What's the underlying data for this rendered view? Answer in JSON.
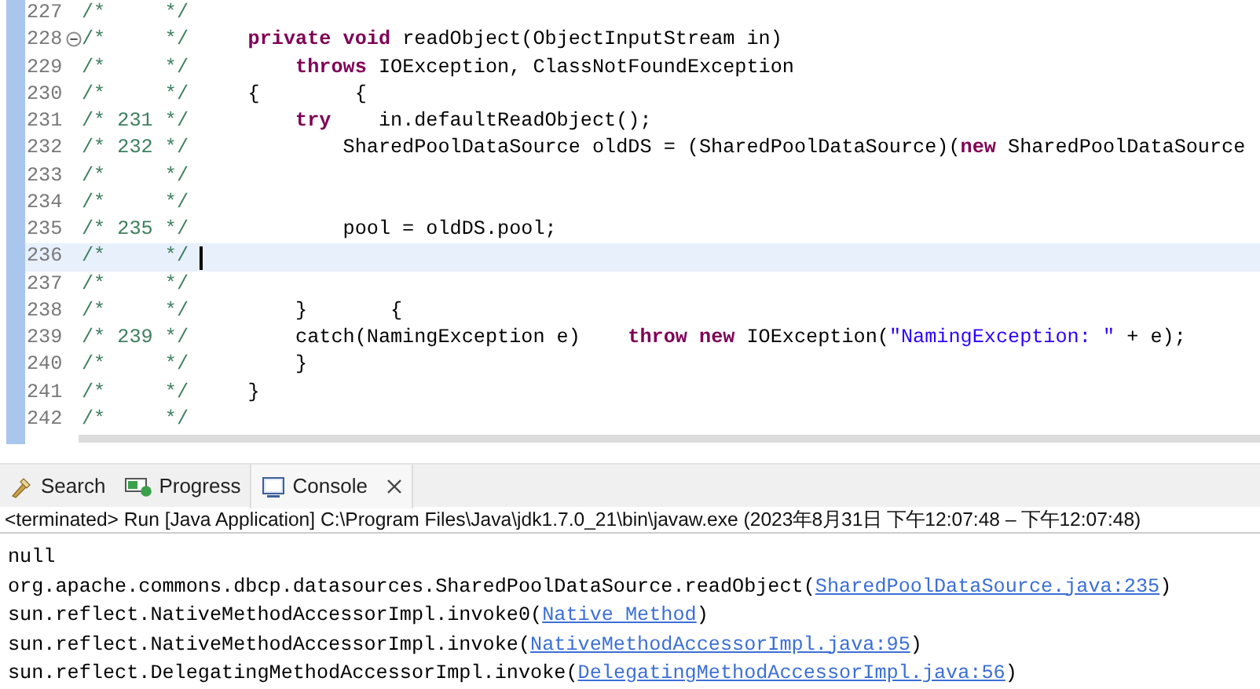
{
  "editor": {
    "lines": [
      {
        "number": "227",
        "collapsible": false,
        "current": false,
        "comment": "/*     */"
      },
      {
        "number": "228",
        "collapsible": true,
        "current": false,
        "comment": "/*     */",
        "tokens": [
          {
            "kind": "keyword",
            "text": "    private"
          },
          {
            "kind": "keyword",
            "text": " void"
          },
          {
            "kind": "plain",
            "text": " readObject(ObjectInputStream in)"
          }
        ]
      },
      {
        "number": "229",
        "collapsible": false,
        "current": false,
        "comment": "/*     */",
        "tokens": [
          {
            "kind": "keyword",
            "text": "        throws"
          },
          {
            "kind": "plain",
            "text": " IOException, ClassNotFoundException"
          }
        ]
      },
      {
        "number": "230",
        "collapsible": false,
        "current": false,
        "comment": "/*     */",
        "tokens": [
          {
            "kind": "plain",
            "text": "    {        {"
          }
        ]
      },
      {
        "number": "231",
        "collapsible": false,
        "current": false,
        "comment": "/* 231 */",
        "tokens": [
          {
            "kind": "keyword",
            "text": "        try"
          },
          {
            "kind": "plain",
            "text": "    in.defaultReadObject();"
          }
        ]
      },
      {
        "number": "232",
        "collapsible": false,
        "current": false,
        "comment": "/* 232 */",
        "tokens": [
          {
            "kind": "plain",
            "text": "            SharedPoolDataSource oldDS = (SharedPoolDataSource)("
          },
          {
            "kind": "keyword",
            "text": "new"
          },
          {
            "kind": "plain",
            "text": " SharedPoolDataSource"
          }
        ]
      },
      {
        "number": "233",
        "collapsible": false,
        "current": false,
        "comment": "/*     */"
      },
      {
        "number": "234",
        "collapsible": false,
        "current": false,
        "comment": "/*     */"
      },
      {
        "number": "235",
        "collapsible": false,
        "current": false,
        "comment": "/* 235 */",
        "tokens": [
          {
            "kind": "plain",
            "text": "            pool = oldDS.pool;"
          }
        ]
      },
      {
        "number": "236",
        "collapsible": false,
        "current": true,
        "comment": "/*     */"
      },
      {
        "number": "237",
        "collapsible": false,
        "current": false,
        "comment": "/*     */"
      },
      {
        "number": "238",
        "collapsible": false,
        "current": false,
        "comment": "/*     */",
        "tokens": [
          {
            "kind": "plain",
            "text": "        }       {"
          }
        ]
      },
      {
        "number": "239",
        "collapsible": false,
        "current": false,
        "comment": "/* 239 */",
        "tokens": [
          {
            "kind": "plain",
            "text": "        catch(NamingException e)"
          },
          {
            "kind": "keyword",
            "text": "    throw"
          },
          {
            "kind": "keyword",
            "text": " new"
          },
          {
            "kind": "plain",
            "text": " IOException("
          },
          {
            "kind": "string",
            "text": "\"NamingException: \""
          },
          {
            "kind": "plain",
            "text": " + e);"
          }
        ]
      },
      {
        "number": "240",
        "collapsible": false,
        "current": false,
        "comment": "/*     */",
        "tokens": [
          {
            "kind": "plain",
            "text": "        }"
          }
        ]
      },
      {
        "number": "241",
        "collapsible": false,
        "current": false,
        "comment": "/*     */",
        "tokens": [
          {
            "kind": "plain",
            "text": "    }"
          }
        ]
      },
      {
        "number": "242",
        "collapsible": false,
        "current": false,
        "comment": "/*     */"
      }
    ]
  },
  "tabs": [
    {
      "label": "Search",
      "selected": false
    },
    {
      "label": "Progress",
      "selected": false
    },
    {
      "label": "Console",
      "selected": true,
      "closable": true
    }
  ],
  "console": {
    "status": "<terminated> Run [Java Application] C:\\Program Files\\Java\\jdk1.7.0_21\\bin\\javaw.exe  (2023年8月31日 下午12:07:48 – 下午12:07:48)",
    "lines": [
      [
        {
          "kind": "plain",
          "text": "null"
        }
      ],
      [
        {
          "kind": "plain",
          "text": "org.apache.commons.dbcp.datasources.SharedPoolDataSource.readObject("
        },
        {
          "kind": "link",
          "text": "SharedPoolDataSource.java:235"
        },
        {
          "kind": "plain",
          "text": ")"
        }
      ],
      [
        {
          "kind": "plain",
          "text": "sun.reflect.NativeMethodAccessorImpl.invoke0("
        },
        {
          "kind": "link",
          "text": "Native Method"
        },
        {
          "kind": "plain",
          "text": ")"
        }
      ],
      [
        {
          "kind": "plain",
          "text": "sun.reflect.NativeMethodAccessorImpl.invoke("
        },
        {
          "kind": "link",
          "text": "NativeMethodAccessorImpl.java:95"
        },
        {
          "kind": "plain",
          "text": ")"
        }
      ],
      [
        {
          "kind": "plain",
          "text": "sun.reflect.DelegatingMethodAccessorImpl.invoke("
        },
        {
          "kind": "link",
          "text": "DelegatingMethodAccessorImpl.java:56"
        },
        {
          "kind": "plain",
          "text": ")"
        }
      ]
    ]
  }
}
